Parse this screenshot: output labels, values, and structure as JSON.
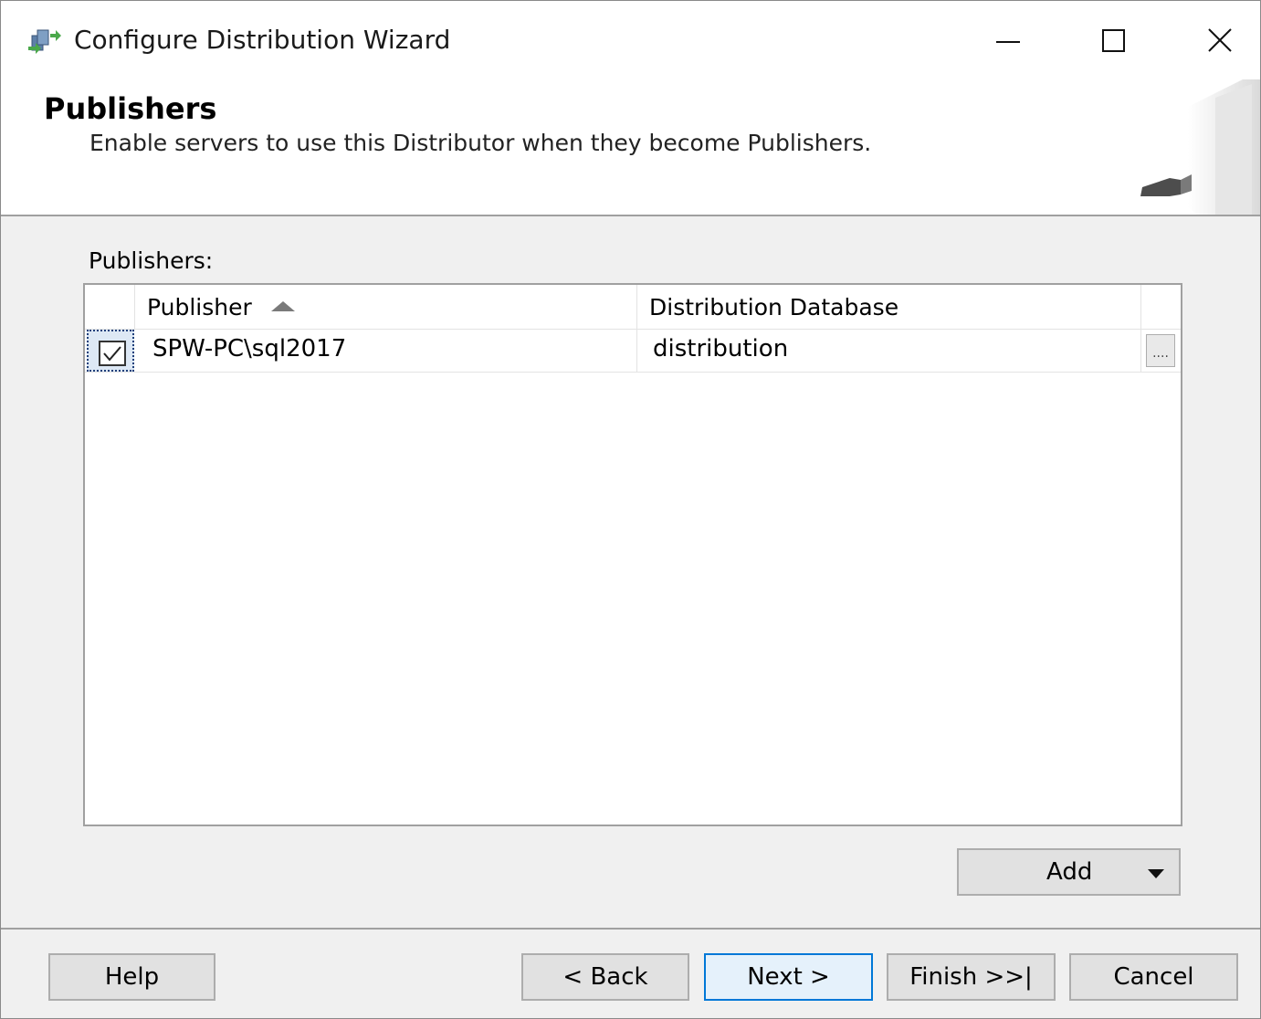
{
  "window": {
    "title": "Configure Distribution Wizard",
    "icon": "replication-wizard-icon",
    "controls": [
      "minimize-icon",
      "maximize-icon",
      "close-icon"
    ]
  },
  "header": {
    "title": "Publishers",
    "subtitle": "Enable servers to use this Distributor when they become Publishers."
  },
  "publishers_list": {
    "label": "Publishers:",
    "columns": {
      "publisher": "Publisher",
      "distribution_database": "Distribution Database"
    },
    "sort": "ascending",
    "rows": [
      {
        "checked": true,
        "publisher": "SPW-PC\\sql2017",
        "distribution_database": "distribution",
        "browse_label": "...."
      }
    ]
  },
  "buttons": {
    "add": "Add",
    "help": "Help",
    "back": "< Back",
    "next": "Next >",
    "finish": "Finish >>|",
    "cancel": "Cancel"
  },
  "colors": {
    "accent": "#0078d7",
    "focused_button_bg": "#e5f1fb",
    "dialog_bg": "#f0f0f0",
    "header_bg": "#ffffff"
  }
}
